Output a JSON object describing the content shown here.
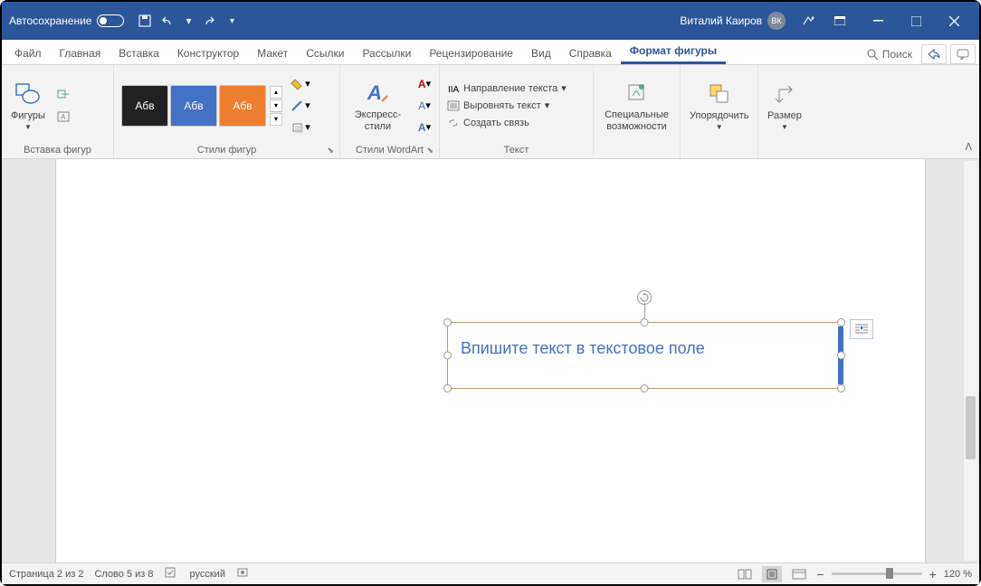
{
  "titlebar": {
    "autosave": "Автосохранение",
    "user_name": "Виталий Каиров",
    "user_initials": "ВК"
  },
  "tabs": {
    "file": "Файл",
    "home": "Главная",
    "insert": "Вставка",
    "design": "Конструктор",
    "layout": "Макет",
    "references": "Ссылки",
    "mailings": "Рассылки",
    "review": "Рецензирование",
    "view": "Вид",
    "help": "Справка",
    "shape_format": "Формат фигуры",
    "search": "Поиск"
  },
  "ribbon": {
    "shapes_btn": "Фигуры",
    "insert_shapes": "Вставка фигур",
    "shape_styles": "Стили фигур",
    "swatch_text": "Абв",
    "express_styles": "Экспресс-стили",
    "wordart_styles": "Стили WordArt",
    "text_group": "Текст",
    "text_direction": "Направление текста",
    "align_text": "Выровнять текст",
    "create_link": "Создать связь",
    "accessibility": "Специальные возможности",
    "arrange": "Упорядочить",
    "size": "Размер"
  },
  "document": {
    "textbox_content": "Впишите текст в текстовое поле"
  },
  "statusbar": {
    "page": "Страница 2 из 2",
    "words": "Слово 5 из 8",
    "language": "русский",
    "zoom": "120 %"
  }
}
